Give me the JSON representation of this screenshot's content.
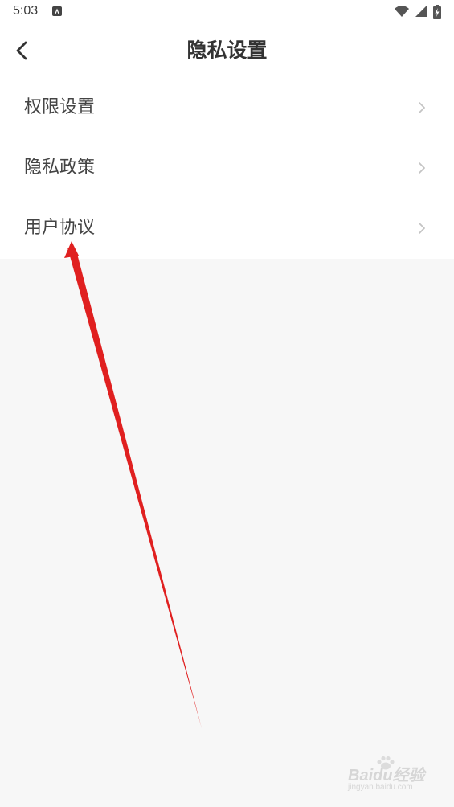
{
  "status_bar": {
    "time": "5:03",
    "icons": [
      "app-notification-icon",
      "wifi-icon",
      "signal-icon",
      "battery-charging-icon"
    ]
  },
  "top_bar": {
    "title": "隐私设置",
    "back_icon": "chevron-left-icon"
  },
  "menu": {
    "items": [
      {
        "label": "权限设置",
        "icon": "chevron-right-icon"
      },
      {
        "label": "隐私政策",
        "icon": "chevron-right-icon"
      },
      {
        "label": "用户协议",
        "icon": "chevron-right-icon"
      }
    ]
  },
  "watermark": {
    "brand": "Baidu经验",
    "url": "jingyan.baidu.com"
  },
  "colors": {
    "page_background": "#f7f7f7",
    "card_background": "#ffffff",
    "text": "#333333",
    "chevron": "#c4c4c4",
    "annotation_arrow": "#e02020"
  }
}
